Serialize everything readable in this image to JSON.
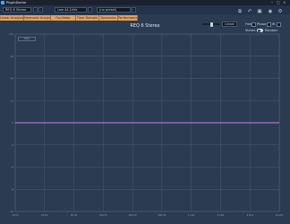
{
  "app": {
    "title": "PluginDoctor"
  },
  "window_controls": {
    "minimize": "–",
    "maximize": "□",
    "close": "×"
  },
  "toolbar": {
    "plugin_combo": "REQ 6 Stereo",
    "rate_combo": "Low 44.1kHz",
    "preset_combo": "(no preset)",
    "prev": "‹",
    "next": "›"
  },
  "tabs": [
    "Linear Analysis",
    "Harmonic Analysis",
    "Oscillator",
    "Time Domain",
    "Dynamics",
    "Performance"
  ],
  "view": {
    "linear_label": "Linear",
    "freq_label": "Freq",
    "phase_label": "Phase",
    "ir_label": "IR",
    "stereo_label": "Stereo",
    "random_label": "Random"
  },
  "chart_data": {
    "type": "line",
    "title": "REQ 6 Stereo",
    "series": [
      {
        "name": "response",
        "values": [
          0,
          0
        ],
        "color": "#c882e0"
      }
    ],
    "x_ticks": [
      "10 Hz",
      "20 Hz",
      "50 Hz",
      "100 Hz",
      "200 Hz",
      "500 Hz",
      "1 kHz",
      "2 kHz",
      "5 kHz",
      "10 kHz"
    ],
    "y_ticks": [
      "+12",
      "+9",
      "+6",
      "+3",
      "0",
      "-3",
      "-6",
      "-9",
      "-12"
    ],
    "grid": true,
    "legend_text": "Mid"
  },
  "colors": {
    "background": "#2b3b52",
    "grid": "#4f6178",
    "tab": "#e0a262",
    "line": "#c882e0"
  }
}
